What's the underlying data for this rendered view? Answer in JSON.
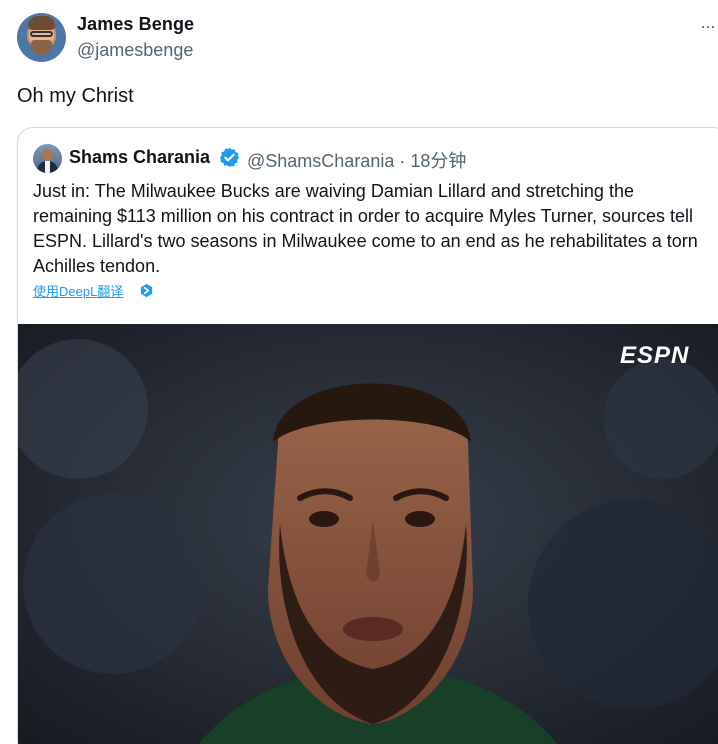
{
  "author": {
    "name": "James Benge",
    "handle": "@jamesbenge",
    "avatar_icon": "user-avatar"
  },
  "more_icon": "more-options-icon",
  "more_label": "···",
  "post_text": "Oh my Christ",
  "quote": {
    "name": "Shams Charania",
    "handle_time": "@ShamsCharania · 18分钟",
    "verified_icon": "verified-badge-icon",
    "verified_color": "#1d9bf0",
    "text": "Just in: The Milwaukee Bucks are waiving Damian Lillard and stretching the remaining $113 million on his contract in order to acquire Myles Turner, sources tell ESPN. Lillard's two seasons in Milwaukee come to an end as he rehabilitates a torn Achilles tendon.",
    "translate_label": "使用DeepL翻译",
    "media": {
      "watermark": "ESPN",
      "alt": "photo"
    }
  },
  "colors": {
    "link": "#1d9bf0",
    "secondary_text": "#536471",
    "border": "#cfd9de"
  }
}
